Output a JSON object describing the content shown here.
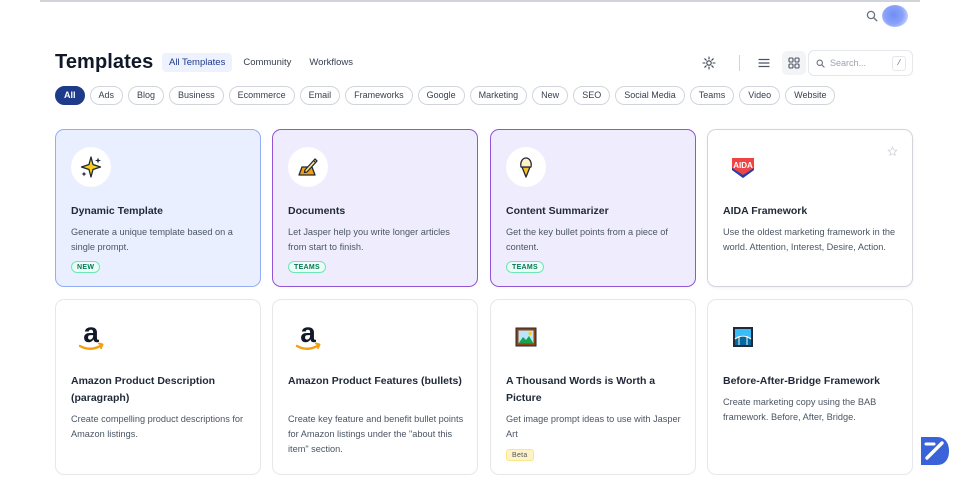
{
  "page_title": "Templates",
  "tabs": [
    {
      "label": "All Templates",
      "active": true
    },
    {
      "label": "Community",
      "active": false
    },
    {
      "label": "Workflows",
      "active": false
    }
  ],
  "search": {
    "placeholder": "Search...",
    "shortcut": "/"
  },
  "filters": [
    "All",
    "Ads",
    "Blog",
    "Business",
    "Ecommerce",
    "Email",
    "Frameworks",
    "Google",
    "Marketing",
    "New",
    "SEO",
    "Social Media",
    "Teams",
    "Video",
    "Website"
  ],
  "active_filter": "All",
  "cards": [
    {
      "title": "Dynamic Template",
      "desc": "Generate a unique template based on a single prompt.",
      "badge": "NEW",
      "icon": "sparkle-icon"
    },
    {
      "title": "Documents",
      "desc": "Let Jasper help you write longer articles from start to finish.",
      "badge": "TEAMS",
      "icon": "pen-paper-icon"
    },
    {
      "title": "Content Summarizer",
      "desc": "Get the key bullet points from a piece of content.",
      "badge": "TEAMS",
      "icon": "ice-cream-icon"
    },
    {
      "title": "AIDA Framework",
      "desc": "Use the oldest marketing framework in the world. Attention, Interest, Desire, Action.",
      "badge": "",
      "icon": "aida-logo-icon",
      "logo_text": "AIDA"
    },
    {
      "title": "Amazon Product Description (paragraph)",
      "desc": "Create compelling product descriptions for Amazon listings.",
      "badge": "",
      "icon": "amazon-logo-icon",
      "logo_text": "a"
    },
    {
      "title": "Amazon Product Features (bullets)",
      "desc": "Create key feature and benefit bullet points for Amazon listings under the \"about this item\" section.",
      "badge": "",
      "icon": "amazon-logo-icon",
      "logo_text": "a"
    },
    {
      "title": "A Thousand Words is Worth a Picture",
      "desc": "Get image prompt ideas to use with Jasper Art",
      "badge": "Beta",
      "icon": "framed-picture-icon"
    },
    {
      "title": "Before-After-Bridge Framework",
      "desc": "Create marketing copy using the BAB framework. Before, After, Bridge.",
      "badge": "",
      "icon": "bridge-picture-icon"
    }
  ],
  "colors": {
    "accent": "#1e3a8a",
    "card_blue_bg": "#e9efff",
    "card_blue_border": "#93adf7",
    "card_purple_bg": "#efecfe",
    "card_purple_border": "#9155d6",
    "badge_green": "#047857"
  }
}
